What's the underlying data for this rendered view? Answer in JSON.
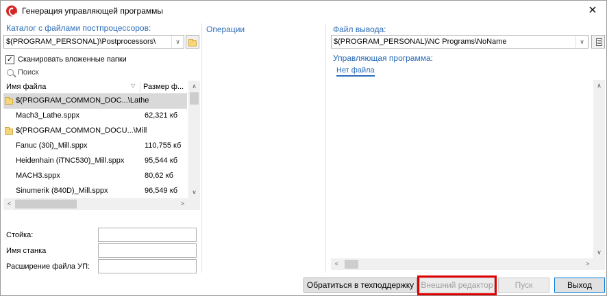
{
  "window": {
    "title": "Генерация управляющей программы"
  },
  "left": {
    "catalog_label": "Каталог с файлами постпроцессоров:",
    "catalog_value": "$(PROGRAM_PERSONAL)\\Postprocessors\\",
    "scan_subfolders_label": "Сканировать вложенные папки",
    "scan_subfolders_checked": true,
    "search_placeholder": "Поиск",
    "columns": [
      "Имя файла",
      "Размер ф..."
    ],
    "rows": [
      {
        "type": "folder",
        "name": "$(PROGRAM_COMMON_DOC...\\Lathe",
        "size": "",
        "selected": true
      },
      {
        "type": "file",
        "name": "Mach3_Lathe.sppx",
        "size": "62,321 кб",
        "selected": false
      },
      {
        "type": "folder",
        "name": "$(PROGRAM_COMMON_DOCU...\\Mill",
        "size": "",
        "selected": false
      },
      {
        "type": "file",
        "name": "Fanuc (30i)_Mill.sppx",
        "size": "110,755 кб",
        "selected": false
      },
      {
        "type": "file",
        "name": "Heidenhain (iTNC530)_Mill.sppx",
        "size": "95,544 кб",
        "selected": false
      },
      {
        "type": "file",
        "name": "MACH3.sppx",
        "size": "80,62 кб",
        "selected": false
      },
      {
        "type": "file",
        "name": "Sinumerik (840D)_Mill.sppx",
        "size": "96,549 кб",
        "selected": false
      }
    ],
    "fields": [
      {
        "label": "Стойка:",
        "value": ""
      },
      {
        "label": "Имя станка",
        "value": ""
      },
      {
        "label": "Расширение файла УП:",
        "value": ""
      }
    ]
  },
  "middle": {
    "operations_label": "Операции"
  },
  "right": {
    "output_file_label": "Файл вывода:",
    "output_file_value": "$(PROGRAM_PERSONAL)\\NC Programs\\NoName",
    "nc_program_label": "Управляющая программа:",
    "no_file_tab": "Нет файла"
  },
  "buttons": {
    "support": "Обратиться в техподдержку",
    "external_editor": "Внешний редактор",
    "run": "Пуск",
    "exit": "Выход"
  },
  "colors": {
    "accent_blue": "#2a6bb8",
    "highlight_red": "#e00000"
  }
}
